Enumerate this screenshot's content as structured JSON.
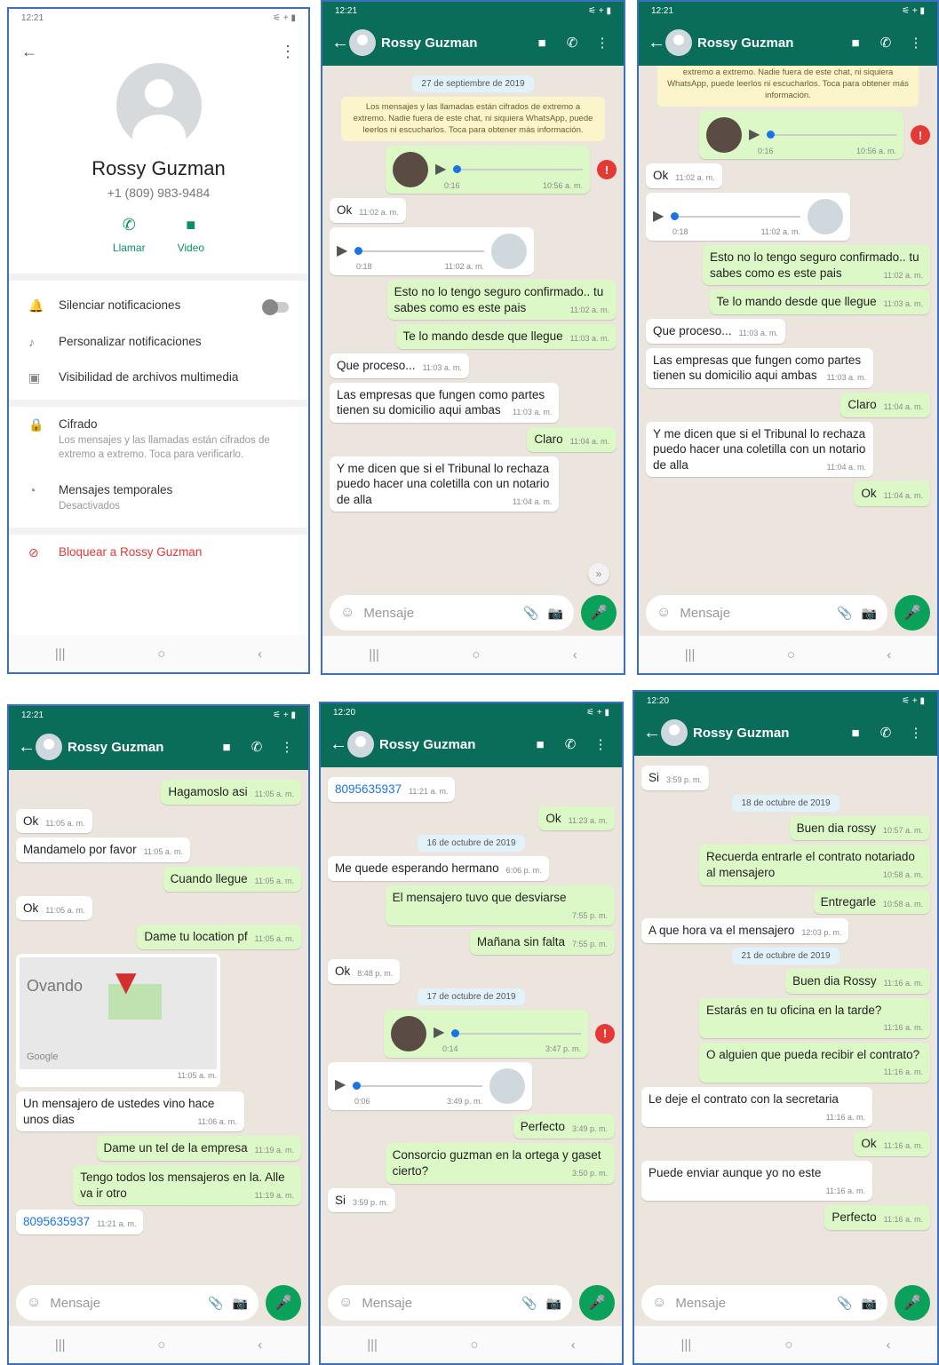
{
  "status": {
    "time1": "12:21",
    "time6": "12:20",
    "icons": "⚟ + ▮"
  },
  "contact": {
    "name": "Rossy Guzman",
    "phone": "+1 (809) 983-9484",
    "call": "Llamar",
    "video": "Video",
    "mute": "Silenciar notificaciones",
    "custom": "Personalizar notificaciones",
    "media": "Visibilidad de archivos multimedia",
    "cipher": "Cifrado",
    "cipher_sub": "Los mensajes y las llamadas están cifrados de extremo a extremo. Toca para verificarlo.",
    "temp": "Mensajes temporales",
    "temp_sub": "Desactivados",
    "block": "Bloquear a Rossy Guzman"
  },
  "input_placeholder": "Mensaje",
  "enc": "Los mensajes y las llamadas están cifrados de extremo a extremo. Nadie fuera de este chat, ni siquiera WhatsApp, puede leerlos ni escucharlos. Toca para obtener más información.",
  "enc_cut": "extremo a extremo. Nadie fuera de este chat, ni siquiera WhatsApp, puede leerlos ni escucharlos. Toca para obtener más información.",
  "m": {
    "d27": "27 de septiembre de 2019",
    "a1d": "0:16",
    "a1t": "10:56 a. m.",
    "ok1": "Ok",
    "ok1t": "11:02 a. m.",
    "a2d": "0:18",
    "a2t": "11:02 a. m.",
    "m3": "Esto no lo tengo seguro confirmado.. tu sabes como es este pais",
    "m3t": "11:02 a. m.",
    "m4": "Te lo mando desde que llegue",
    "m4t": "11:03 a. m.",
    "m5": "Que proceso...",
    "m5t": "11:03 a. m.",
    "m6": "Las empresas que fungen como partes tienen su domicilio aqui ambas",
    "m6t": "11:03 a. m.",
    "m7": "Claro",
    "m7t": "11:04 a. m.",
    "m8": "Y me dicen que si el Tribunal  lo rechaza puedo hacer una coletilla con un notario de alla",
    "m8t": "11:04 a. m.",
    "m9": "Ok",
    "m9t": "11:04 a. m.",
    "h1": "Hagamoslo asi",
    "h1t": "11:05 a. m.",
    "h2": "Ok",
    "h2t": "11:05 a. m.",
    "h3": "Mandamelo por favor",
    "h3t": "11:05 a. m.",
    "h4": "Cuando llegue",
    "h4t": "11:05 a. m.",
    "h5": "Ok",
    "h5t": "11:05 a. m.",
    "h6": "Dame tu location pf",
    "h6t": "11:05 a. m.",
    "map_label": "Ovando",
    "map_logo": "Google",
    "map_t": "11:05 a. m.",
    "h7": "Un mensajero de ustedes vino hace unos dias",
    "h7t": "11:06 a. m.",
    "h8": "Dame un tel de la empresa",
    "h8t": "11:19 a. m.",
    "h9": "Tengo todos los mensajeros en la. Alle va ir otro",
    "h9t": "11:19 a. m.",
    "h10": "8095635937",
    "h10t": "11:21 a. m.",
    "d16": "16 de octubre de 2019",
    "e1": "Me quede esperando hermano",
    "e1t": "6:06 p. m.",
    "e2": "El mensajero tuvo que desviarse",
    "e2t": "7:55 p. m.",
    "e3": "Mañana sin falta",
    "e3t": "7:55 p. m.",
    "e4": "Ok",
    "e4t": "8:48 p. m.",
    "d17": "17 de octubre de 2019",
    "a3d": "0:14",
    "a3t": "3:47 p. m.",
    "a4d": "0:06",
    "a4t": "3:49 p. m.",
    "e5": "Perfecto",
    "e5t": "3:49 p. m.",
    "e6": "Consorcio guzman en la ortega y gaset cierto?",
    "e6t": "3:50 p. m.",
    "e7": "Si",
    "e7t": "3:59 p. m.",
    "ok2": "Ok",
    "ok2t": "11:23 a. m.",
    "d18": "18 de octubre de 2019",
    "f1": "Buen dia rossy",
    "f1t": "10:57 a. m.",
    "f2": "Recuerda entrarle el contrato notariado al mensajero",
    "f2t": "10:58 a. m.",
    "f3": "Entregarle",
    "f3t": "10:58 a. m.",
    "f4": "A que hora va el mensajero",
    "f4t": "12:03 p. m.",
    "d21": "21 de octubre de 2019",
    "f5": "Buen dia Rossy",
    "f5t": "11:16 a. m.",
    "f6": "Estarás en tu oficina en la tarde?",
    "f6t": "11:16 a. m.",
    "f7": "O alguien que pueda recibir el contrato?",
    "f7t": "11:16 a. m.",
    "f8": "Le deje el contrato con la secretaria",
    "f8t": "11:16 a. m.",
    "f9": "Ok",
    "f9t": "11:16 a. m.",
    "f10": "Puede enviar aunque yo no este",
    "f10t": "11:16 a. m.",
    "f11": "Perfecto",
    "f11t": "11:16 a. m."
  }
}
